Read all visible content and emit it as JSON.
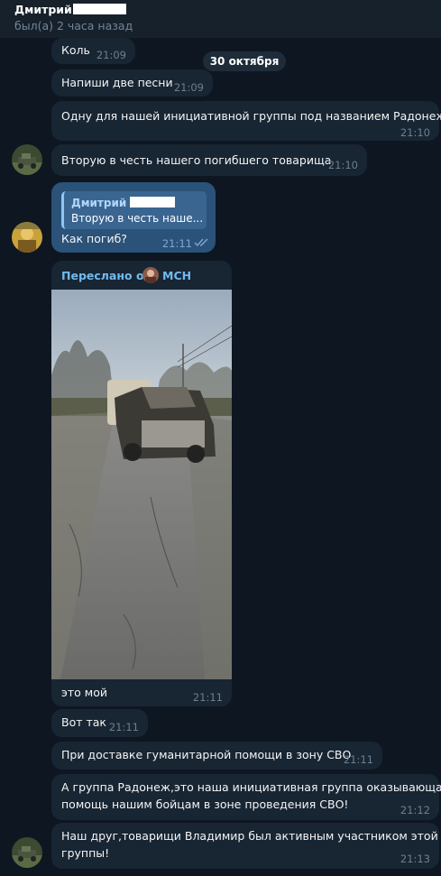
{
  "header": {
    "contact_name": "Дмитрий",
    "status": "был(а) 2 часа назад"
  },
  "date_separator": "30 октября",
  "messages": [
    {
      "text": "Коль",
      "time": "21:09"
    },
    {
      "text": "Напиши две песни",
      "time": "21:09"
    },
    {
      "text": "Одну для нашей инициативной группы под названием Радонеж!",
      "time": "21:10"
    },
    {
      "text": "Вторую в честь нашего погибшего товарища",
      "time": "21:10"
    },
    {
      "reply_name": "Дмитрий",
      "reply_text": "Вторую в честь наше...",
      "text": "Как погиб?",
      "time": "21:11",
      "read": true
    },
    {
      "forwarded_label": "Переслано от",
      "forwarded_from": "МСН",
      "caption": "это мой",
      "time": "21:11"
    },
    {
      "text": "Вот так",
      "time": "21:11"
    },
    {
      "text": "При доставке гуманитарной помощи в зону СВО",
      "time": "21:11"
    },
    {
      "line1": "А группа Радонеж,это наша инициативная группа оказывающая",
      "line2": "помощь нашим бойцам в зоне проведения СВО!",
      "time": "21:12"
    },
    {
      "line1": "Наш друг,товарищи Владимир был активным участником этой",
      "line2": "группы!",
      "time": "21:13"
    }
  ],
  "colors": {
    "background": "#0e1621",
    "incoming_bubble": "#182533",
    "outgoing_bubble": "#2b5278",
    "accent": "#71baf0"
  },
  "icons": [
    "double-check-icon"
  ]
}
